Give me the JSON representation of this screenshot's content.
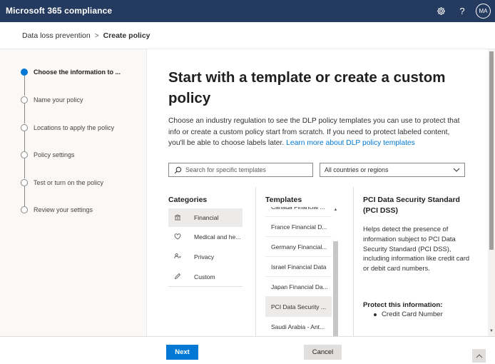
{
  "app": {
    "title": "Microsoft 365 compliance",
    "icons": [
      "gear-icon",
      "help-icon"
    ],
    "help_glyph": "?",
    "user_initials": "MA",
    "bar_color": "#243a5e"
  },
  "breadcrumb": {
    "parent": "Data loss prevention",
    "separator": ">",
    "current": "Create policy"
  },
  "wizard": {
    "steps": [
      {
        "label": "Choose the information to ...",
        "active": true
      },
      {
        "label": "Name your policy",
        "active": false
      },
      {
        "label": "Locations to apply the policy",
        "active": false
      },
      {
        "label": "Policy settings",
        "active": false
      },
      {
        "label": "Test or turn on the policy",
        "active": false
      },
      {
        "label": "Review your settings",
        "active": false
      }
    ]
  },
  "main": {
    "heading": "Start with a template or create a custom policy",
    "description": "Choose an industry regulation to see the DLP policy templates you can use to protect that info or create a custom policy start from scratch. If you need to protect labeled content, you'll be able to choose labels later.",
    "learn_more": "Learn more about DLP policy templates",
    "search_placeholder": "Search for specific templates",
    "region_value": "All countries or regions"
  },
  "categories": {
    "heading": "Categories",
    "items": [
      {
        "label": "Financial",
        "icon": "bank-icon",
        "selected": true
      },
      {
        "label": "Medical and he...",
        "icon": "medical-icon",
        "selected": false
      },
      {
        "label": "Privacy",
        "icon": "privacy-icon",
        "selected": false
      },
      {
        "label": "Custom",
        "icon": "pencil-icon",
        "selected": false
      }
    ]
  },
  "templates": {
    "heading": "Templates",
    "items": [
      {
        "label": "Canada Financial ...",
        "selected": false
      },
      {
        "label": "France Financial D...",
        "selected": false
      },
      {
        "label": "Germany Financial...",
        "selected": false
      },
      {
        "label": "Israel Financial Data",
        "selected": false
      },
      {
        "label": "Japan Financial Da...",
        "selected": false
      },
      {
        "label": "PCI Data Security ...",
        "selected": true
      },
      {
        "label": "Saudi Arabia - Ant...",
        "selected": false
      }
    ]
  },
  "details": {
    "title": "PCI Data Security Standard (PCI DSS)",
    "description": "Helps detect the presence of information subject to PCI Data Security Standard (PCI DSS), including information like credit card or debit card numbers.",
    "protect_heading": "Protect this information:",
    "protect_items": [
      "Credit Card Number"
    ]
  },
  "footer": {
    "next_label": "Next",
    "cancel_label": "Cancel"
  },
  "colors": {
    "accent": "#0078d4",
    "selected_bg": "#edebe9"
  }
}
